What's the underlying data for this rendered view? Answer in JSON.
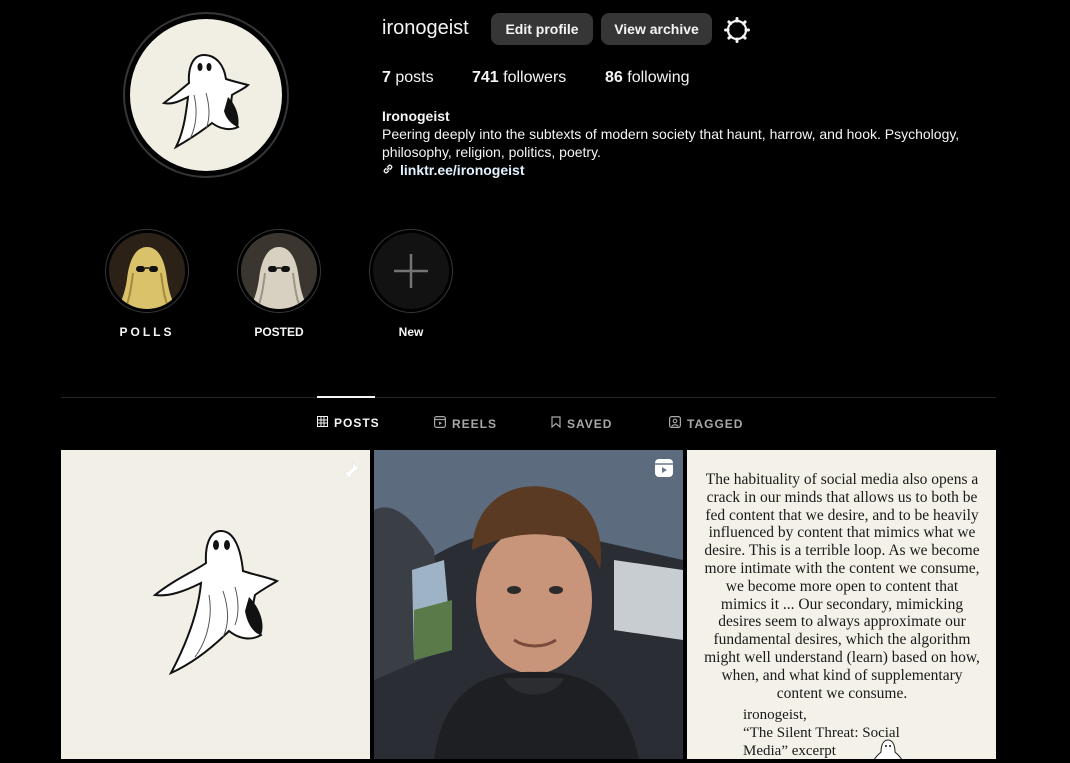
{
  "profile": {
    "username": "ironogeist",
    "edit_label": "Edit profile",
    "archive_label": "View archive",
    "stats": {
      "posts_count": "7",
      "posts_label": " posts",
      "followers_count": "741",
      "followers_label": " followers",
      "following_count": "86",
      "following_label": " following"
    },
    "bio_name": "Ironogeist",
    "bio_text": "Peering deeply into the subtexts of modern society that haunt, harrow, and hook. Psychology, philosophy, religion, politics, poetry.",
    "link": "linktr.ee/ironogeist"
  },
  "highlights": [
    {
      "label": "POLLS"
    },
    {
      "label": "POSTED"
    },
    {
      "label": "New"
    }
  ],
  "tabs": [
    {
      "label": "POSTS",
      "icon": "grid-icon"
    },
    {
      "label": "REELS",
      "icon": "reels-icon"
    },
    {
      "label": "SAVED",
      "icon": "bookmark-icon"
    },
    {
      "label": "TAGGED",
      "icon": "tag-icon"
    }
  ],
  "posts": {
    "quote_lines": [
      "The habituality of social media also opens a",
      "crack in our minds that allows us to both be",
      "fed content that we desire, and to be heavily",
      "influenced by content that mimics what we",
      "desire. This is a terrible loop. As we become",
      "more intimate with the content we consume,",
      "we become more open to content that",
      "mimics it ... Our secondary, mimicking",
      "desires seem to always approximate our",
      "fundamental desires, which the algorithm",
      "might well understand (learn) based on how,",
      "when, and what kind of supplementary",
      "content we consume."
    ],
    "attribution_lines": [
      "ironogeist,",
      "“The Silent Threat: Social",
      "Media” excerpt"
    ]
  }
}
